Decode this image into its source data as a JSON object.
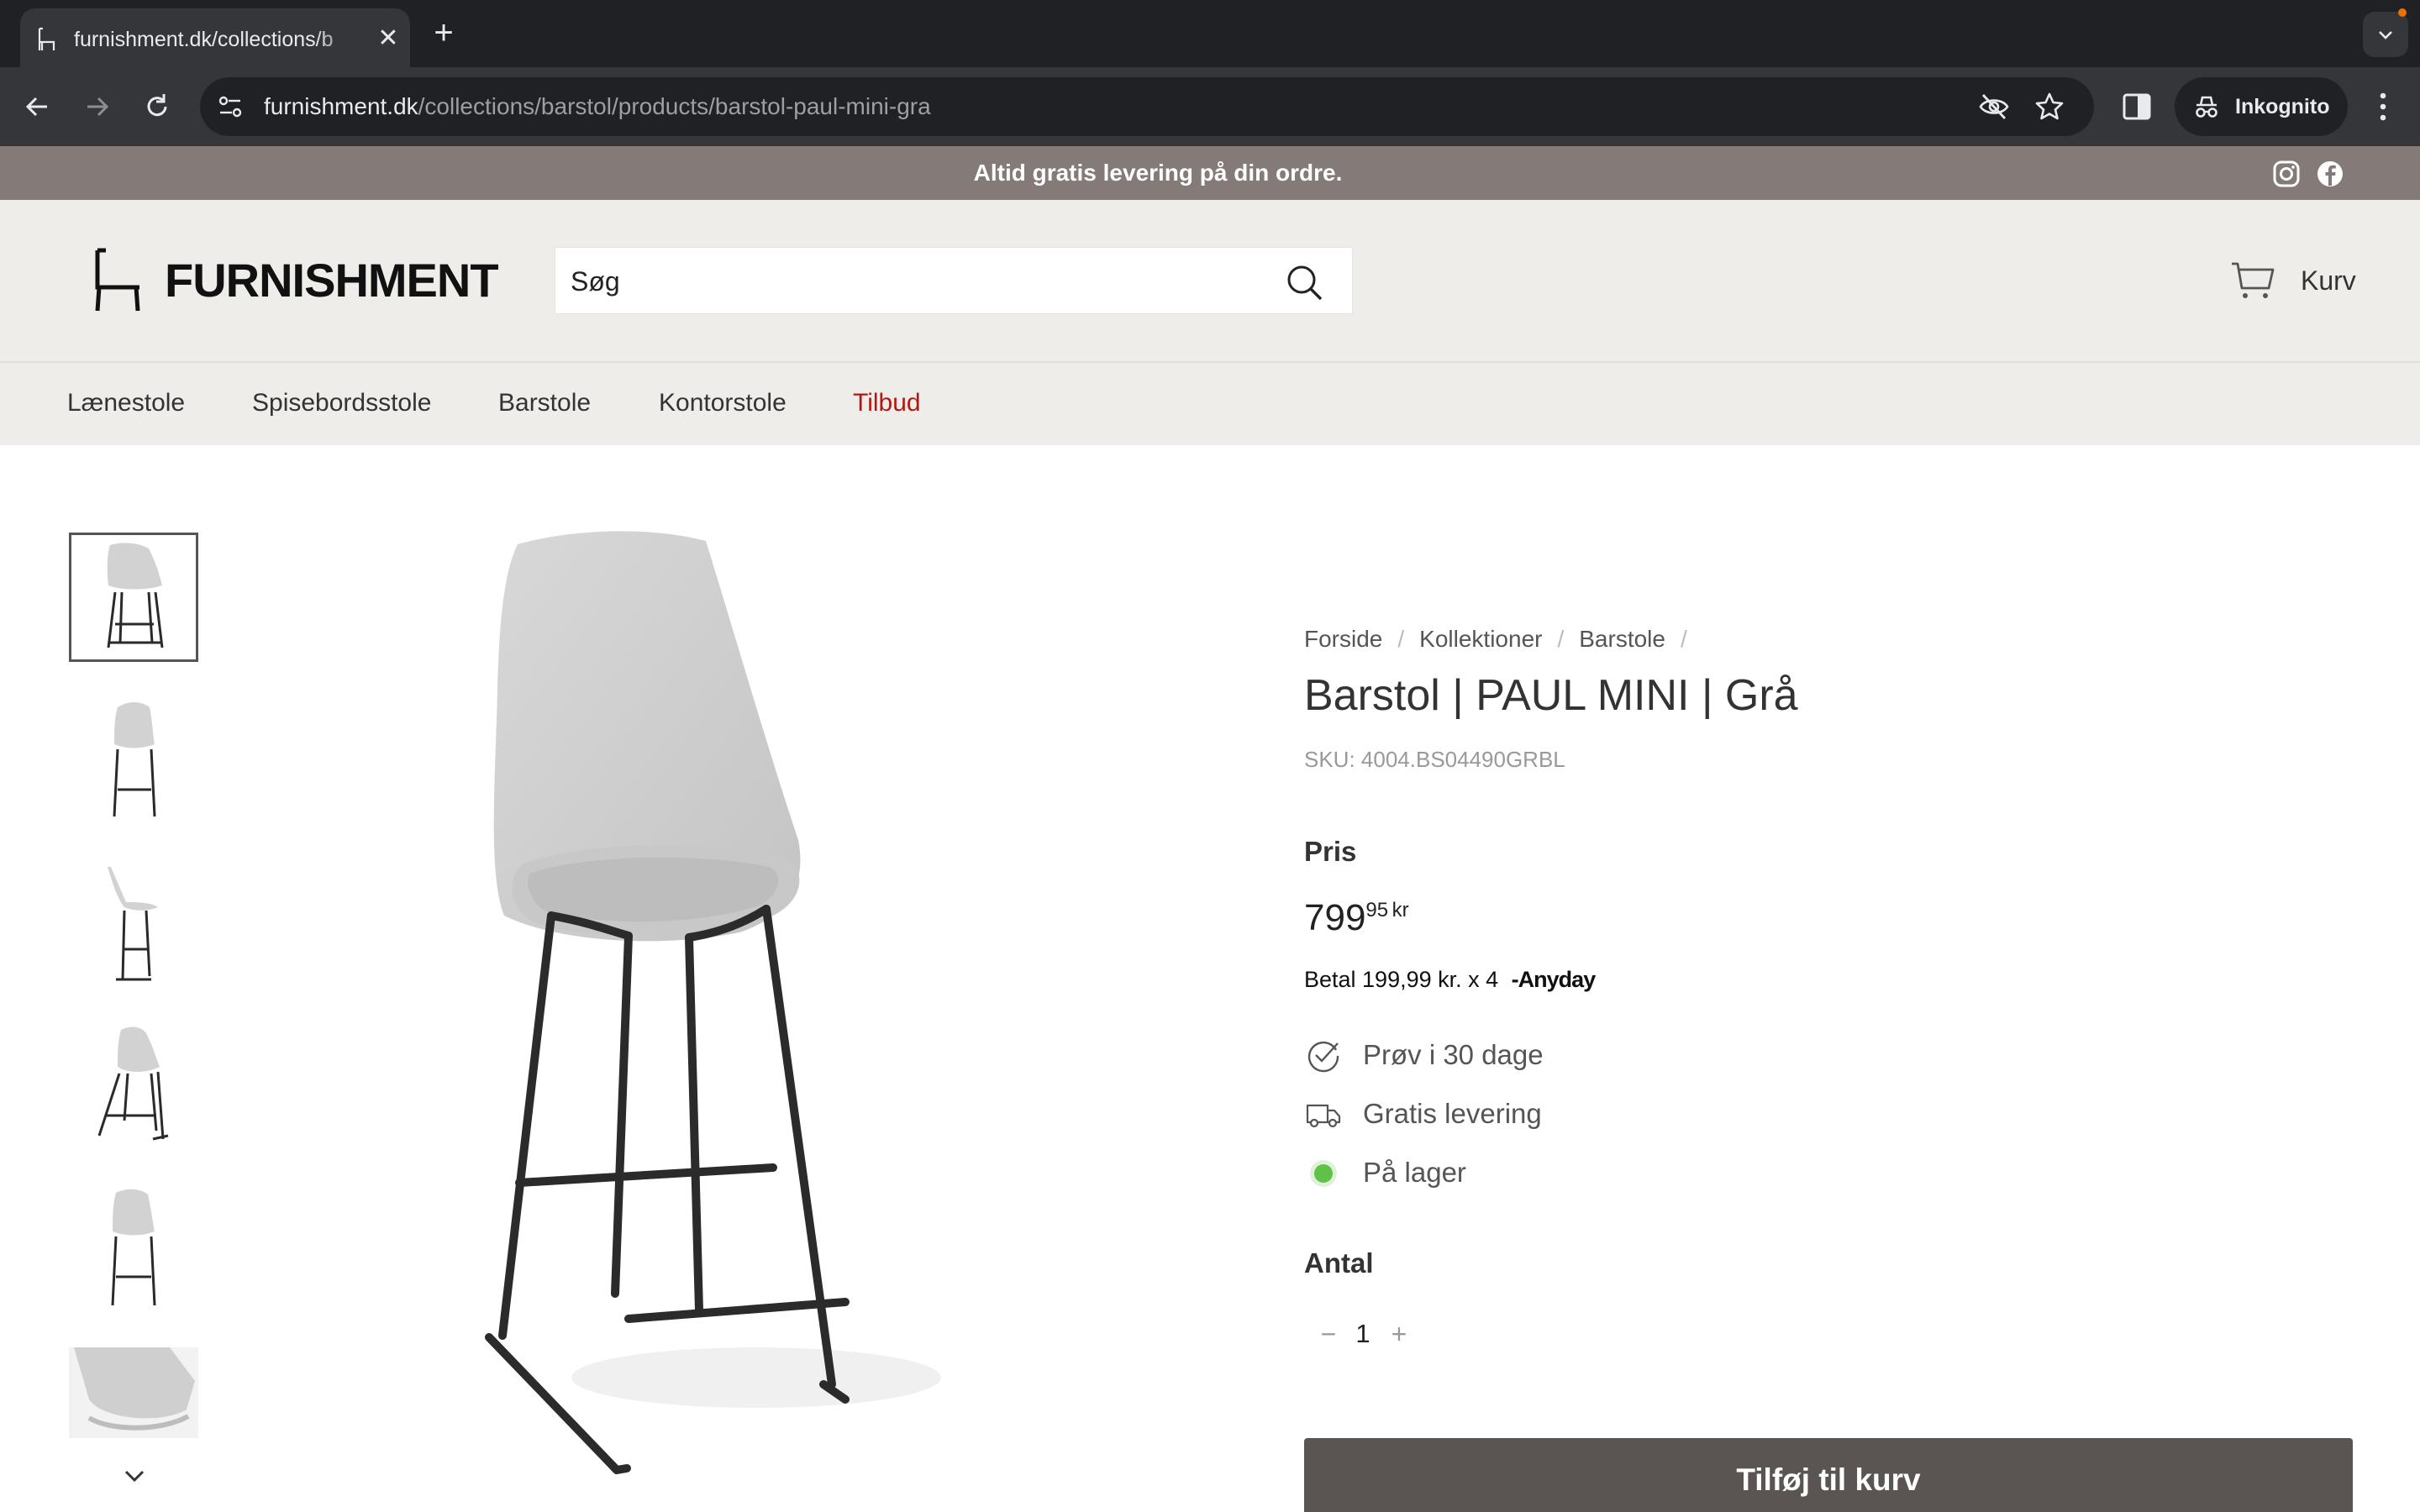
{
  "browser": {
    "tab_title": "furnishment.dk/collections/b",
    "url_host": "furnishment.dk",
    "url_path": "/collections/barstol/products/barstol-paul-mini-gra",
    "incognito_label": "Inkognito"
  },
  "announcement": {
    "text": "Altid gratis levering på din ordre."
  },
  "header": {
    "logo_text": "FURNISHMENT",
    "search_placeholder": "Søg",
    "cart_label": "Kurv"
  },
  "nav": {
    "items": [
      {
        "label": "Lænestole"
      },
      {
        "label": "Spisebordsstole"
      },
      {
        "label": "Barstole"
      },
      {
        "label": "Kontorstole"
      },
      {
        "label": "Tilbud"
      }
    ]
  },
  "product": {
    "breadcrumb": [
      "Forside",
      "Kollektioner",
      "Barstole"
    ],
    "breadcrumb_sep": "/",
    "title": "Barstol | PAUL MINI | Grå",
    "sku": "SKU: 4004.BS04490GRBL",
    "price_label": "Pris",
    "price_main": "799",
    "price_cents": "95",
    "price_currency": "kr",
    "anyday_text": "Betal 199,99 kr. x 4",
    "anyday_logo": "Anyday",
    "features": [
      {
        "icon": "check-circle-icon",
        "label": "Prøv i 30 dage"
      },
      {
        "icon": "truck-icon",
        "label": "Gratis levering"
      },
      {
        "icon": "stock-dot",
        "label": "På lager"
      }
    ],
    "quantity_label": "Antal",
    "quantity_value": "1",
    "qty_minus": "−",
    "qty_plus": "+",
    "add_to_cart_label": "Tilføj til kurv"
  },
  "colors": {
    "announce_bg": "#847a78",
    "header_bg": "#efedea",
    "sale_red": "#b3180f",
    "button_bg": "#5a5552",
    "stock_green": "#5ec148"
  }
}
